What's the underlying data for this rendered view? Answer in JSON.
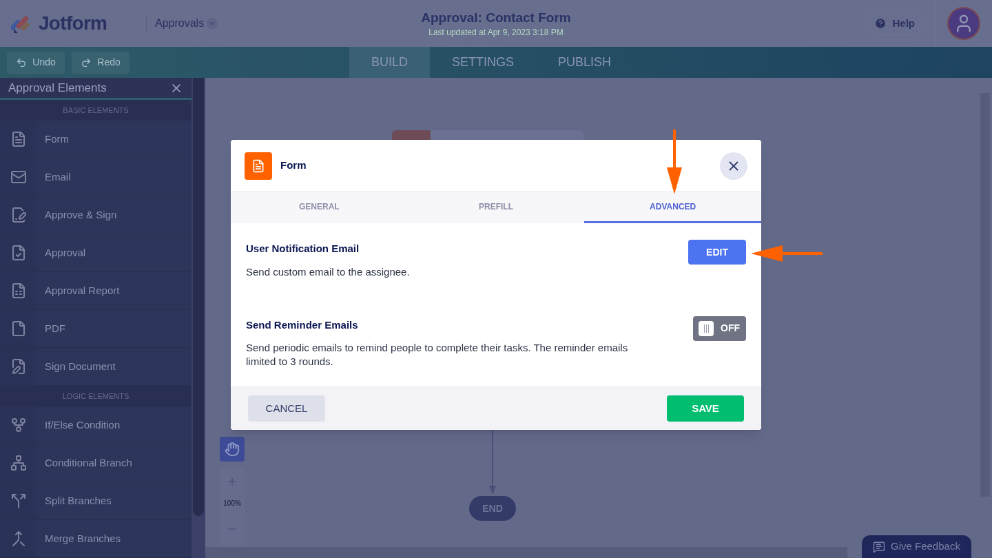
{
  "header": {
    "logo": "Jotform",
    "breadcrumb": "Approvals",
    "title": "Approval: Contact Form",
    "subtitle": "Last updated at Apr 9, 2023 3:18 PM",
    "help": "Help"
  },
  "toolbar": {
    "undo": {
      "label": "Undo",
      "disabled": true
    },
    "redo": {
      "label": "Redo",
      "disabled": true
    },
    "tabs": [
      {
        "label": "BUILD",
        "selected": true
      },
      {
        "label": "SETTINGS",
        "selected": false
      },
      {
        "label": "PUBLISH",
        "selected": false
      }
    ]
  },
  "sidebar": {
    "title": "Approval Elements",
    "sections": [
      {
        "heading": "BASIC ELEMENTS",
        "items": [
          {
            "label": "Form"
          },
          {
            "label": "Email"
          },
          {
            "label": "Approve & Sign"
          },
          {
            "label": "Approval"
          },
          {
            "label": "Approval Report"
          },
          {
            "label": "PDF"
          },
          {
            "label": "Sign Document"
          }
        ]
      },
      {
        "heading": "LOGIC ELEMENTS",
        "items": [
          {
            "label": "If/Else Condition"
          },
          {
            "label": "Conditional Branch"
          },
          {
            "label": "Split Branches"
          },
          {
            "label": "Merge Branches"
          }
        ]
      }
    ]
  },
  "canvas": {
    "end_node": "END",
    "zoom": "100%"
  },
  "feedback": "Give Feedback",
  "modal": {
    "title": "Form",
    "tabs": [
      {
        "label": "GENERAL",
        "selected": false
      },
      {
        "label": "PREFILL",
        "selected": false
      },
      {
        "label": "ADVANCED",
        "selected": true
      }
    ],
    "settings": [
      {
        "kind": "button",
        "title": "User Notification Email",
        "description": "Send custom email to the assignee.",
        "button": "EDIT"
      },
      {
        "kind": "toggle",
        "title": "Send Reminder Emails",
        "description": "Send periodic emails to remind people to complete their tasks. The reminder emails limited to 3 rounds.",
        "on": false,
        "state_label": "OFF"
      }
    ],
    "cancel": "CANCEL",
    "save": "SAVE"
  }
}
